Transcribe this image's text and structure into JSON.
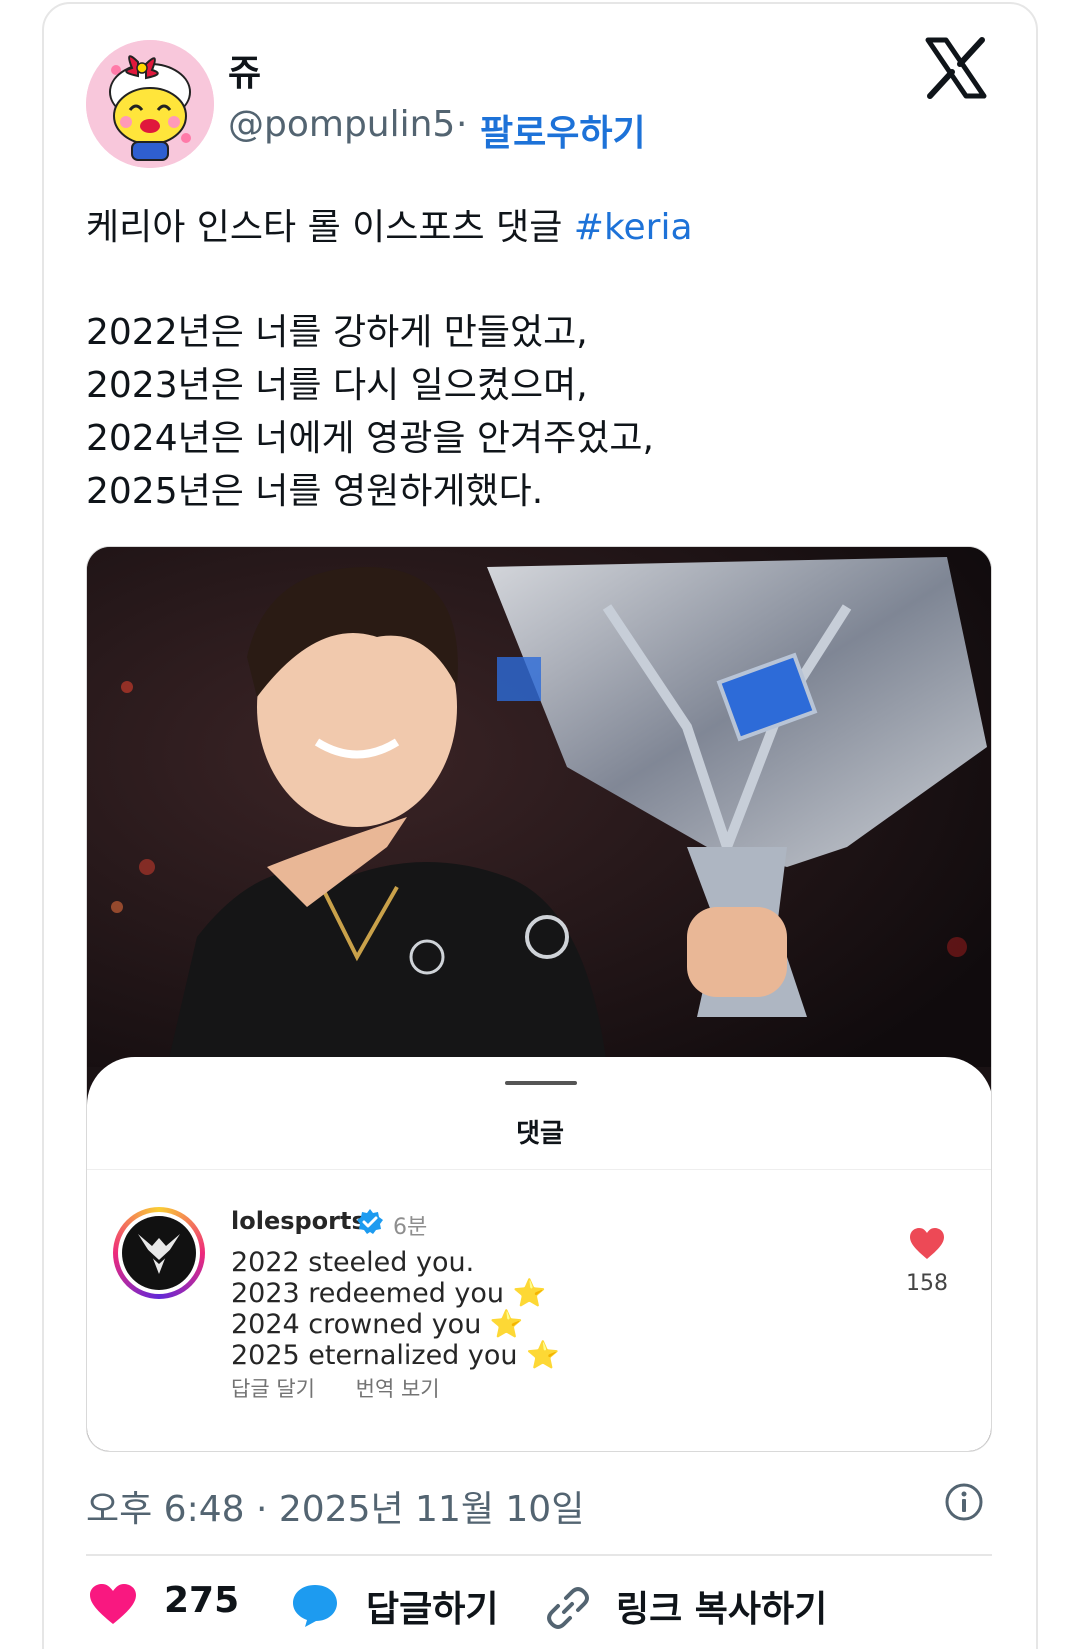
{
  "tweet": {
    "display_name": "쥬",
    "handle": "@pompulin5",
    "separator": "·",
    "follow_label": "팔로우하기",
    "text_first": "케리아 인스타 롤 이스포츠 댓글",
    "hashtag": "#keria",
    "body_lines": [
      "2022년은 너를 강하게 만들었고,",
      "2023년은 너를 다시 일으켰으며,",
      "2024년은 너에게 영광을 안겨주었고,",
      "2025년은 너를 영원하게했다."
    ],
    "timestamp": "오후 6:48 · 2025년 11월 10일"
  },
  "media": {
    "sheet_title": "댓글",
    "comment": {
      "username": "lolesports",
      "time": "6분",
      "lines": [
        "2022 steeled you.",
        "2023 redeemed you",
        "2024 crowned you",
        "2025 eternalized you"
      ],
      "star": "⭐",
      "reply_label": "답글 달기",
      "translate_label": "번역 보기",
      "likes": "158"
    }
  },
  "actions": {
    "like_count": "275",
    "reply_label": "답글하기",
    "copy_link_label": "링크 복사하기"
  },
  "colors": {
    "link_blue": "#1d72d8",
    "like_pink": "#f91880",
    "reply_blue": "#1d9bf0",
    "heart_red": "#ed4956"
  }
}
